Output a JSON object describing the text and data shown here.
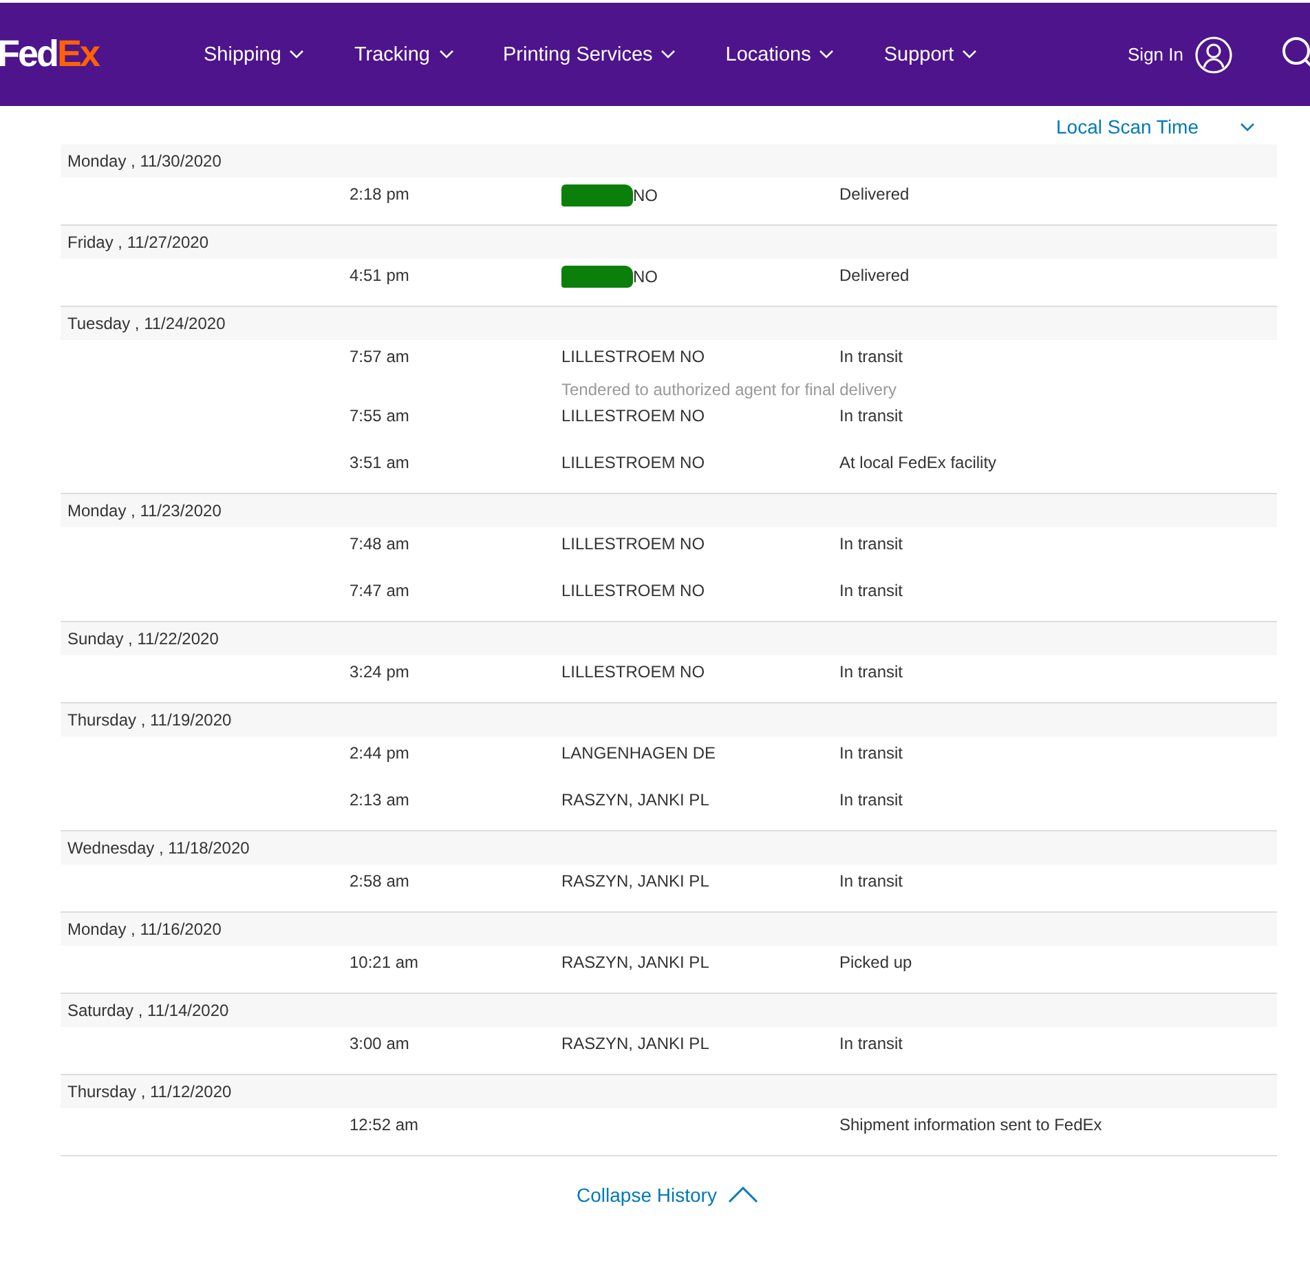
{
  "header": {
    "logo": {
      "fed": "Fed",
      "ex": "Ex"
    },
    "nav": [
      {
        "label": "Shipping"
      },
      {
        "label": "Tracking"
      },
      {
        "label": "Printing Services"
      },
      {
        "label": "Locations"
      },
      {
        "label": "Support"
      }
    ],
    "sign_in": "Sign In"
  },
  "sort": {
    "label": "Local Scan Time"
  },
  "days": [
    {
      "date": "Monday , 11/30/2020",
      "events": [
        {
          "time": "2:18 pm",
          "redacted": true,
          "location": "NO",
          "status": "Delivered"
        }
      ]
    },
    {
      "date": "Friday , 11/27/2020",
      "events": [
        {
          "time": "4:51 pm",
          "redacted": true,
          "location": "NO",
          "status": "Delivered"
        }
      ]
    },
    {
      "date": "Tuesday , 11/24/2020",
      "events": [
        {
          "time": "7:57 am",
          "redacted": false,
          "location": "LILLESTROEM NO",
          "status": "In transit",
          "note": "Tendered to authorized agent for final delivery"
        },
        {
          "time": "7:55 am",
          "redacted": false,
          "location": "LILLESTROEM NO",
          "status": "In transit"
        },
        {
          "time": "3:51 am",
          "redacted": false,
          "location": "LILLESTROEM NO",
          "status": "At local FedEx facility"
        }
      ]
    },
    {
      "date": "Monday , 11/23/2020",
      "events": [
        {
          "time": "7:48 am",
          "redacted": false,
          "location": "LILLESTROEM NO",
          "status": "In transit"
        },
        {
          "time": "7:47 am",
          "redacted": false,
          "location": "LILLESTROEM NO",
          "status": "In transit"
        }
      ]
    },
    {
      "date": "Sunday , 11/22/2020",
      "events": [
        {
          "time": "3:24 pm",
          "redacted": false,
          "location": "LILLESTROEM NO",
          "status": "In transit"
        }
      ]
    },
    {
      "date": "Thursday , 11/19/2020",
      "events": [
        {
          "time": "2:44 pm",
          "redacted": false,
          "location": "LANGENHAGEN DE",
          "status": "In transit"
        },
        {
          "time": "2:13 am",
          "redacted": false,
          "location": "RASZYN, JANKI PL",
          "status": "In transit"
        }
      ]
    },
    {
      "date": "Wednesday , 11/18/2020",
      "events": [
        {
          "time": "2:58 am",
          "redacted": false,
          "location": "RASZYN, JANKI PL",
          "status": "In transit"
        }
      ]
    },
    {
      "date": "Monday , 11/16/2020",
      "events": [
        {
          "time": "10:21 am",
          "redacted": false,
          "location": "RASZYN, JANKI PL",
          "status": "Picked up"
        }
      ]
    },
    {
      "date": "Saturday , 11/14/2020",
      "events": [
        {
          "time": "3:00 am",
          "redacted": false,
          "location": "RASZYN, JANKI PL",
          "status": "In transit"
        }
      ]
    },
    {
      "date": "Thursday , 11/12/2020",
      "events": [
        {
          "time": "12:52 am",
          "redacted": false,
          "status": "Shipment information sent to FedEx"
        }
      ]
    }
  ],
  "collapse": {
    "label": "Collapse History"
  }
}
